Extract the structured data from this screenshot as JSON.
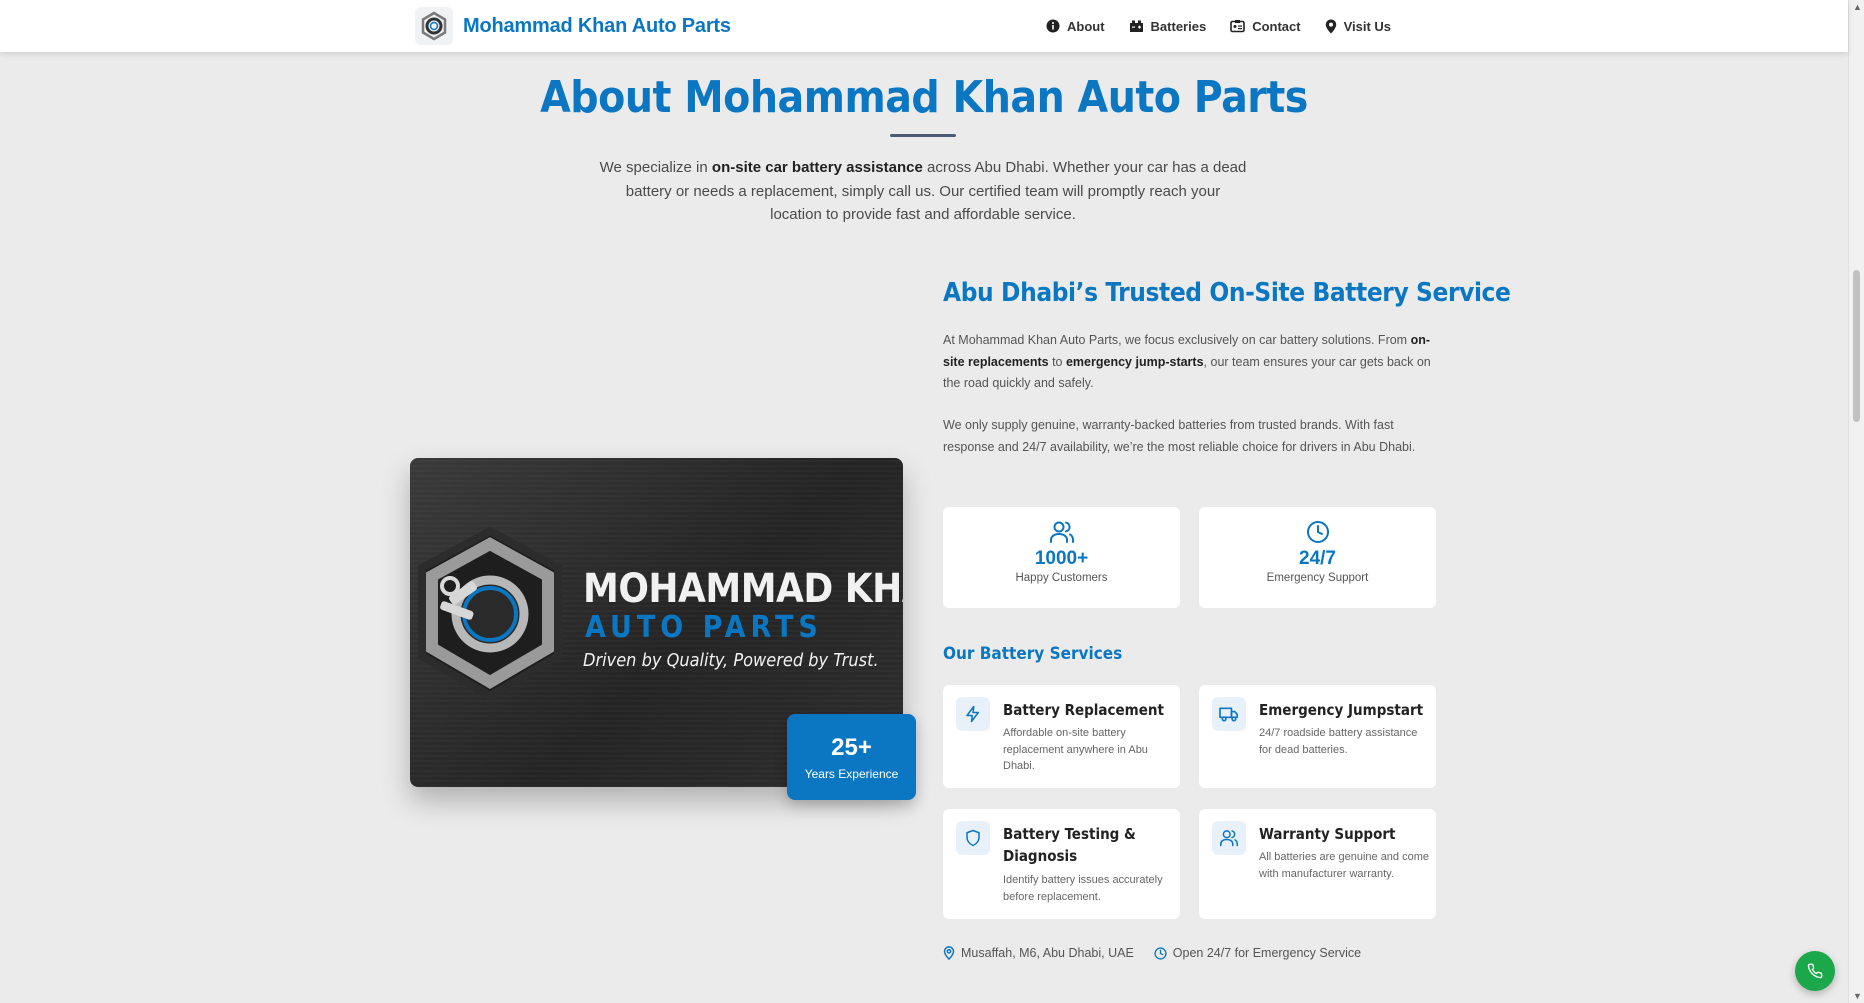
{
  "header": {
    "brand_name": "Mohammad Khan Auto Parts",
    "nav": [
      {
        "label": "About",
        "icon": "info-icon"
      },
      {
        "label": "Batteries",
        "icon": "battery-icon"
      },
      {
        "label": "Contact",
        "icon": "contact-card-icon"
      },
      {
        "label": "Visit Us",
        "icon": "map-pin-icon"
      }
    ]
  },
  "about": {
    "title": "About Mohammad Khan Auto Parts",
    "intro_pre": "We specialize in ",
    "intro_bold": "on-site car battery assistance",
    "intro_post": " across Abu Dhabi. Whether your car has a dead battery or needs a replacement, simply call us. Our certified team will promptly reach your location to provide fast and affordable service."
  },
  "image_card": {
    "line1": "MOHAMMAD KHAN",
    "line2": "AUTO PARTS",
    "tagline": "Driven by Quality, Powered by Trust.",
    "badge_number": "25+",
    "badge_label": "Years Experience"
  },
  "service": {
    "title": "Abu Dhabi’s Trusted On-Site Battery Service",
    "p1_a": "At Mohammad Khan Auto Parts, we focus exclusively on car battery solutions. From ",
    "p1_b1": "on-site replacements",
    "p1_c": " to ",
    "p1_b2": "emergency jump-starts",
    "p1_d": ", our team ensures your car gets back on the road quickly and safely.",
    "p2": "We only supply genuine, warranty-backed batteries from trusted brands. With fast response and 24/7 availability, we’re the most reliable choice for drivers in Abu Dhabi."
  },
  "stats": [
    {
      "value": "1000+",
      "label": "Happy Customers",
      "icon": "users-icon"
    },
    {
      "value": "24/7",
      "label": "Emergency Support",
      "icon": "clock-icon"
    }
  ],
  "services_title": "Our Battery Services",
  "services": [
    {
      "title": "Battery Replacement",
      "desc": "Affordable on-site battery replacement anywhere in Abu Dhabi.",
      "icon": "lightning-icon"
    },
    {
      "title": "Emergency Jumpstart",
      "desc": "24/7 roadside battery assistance for dead batteries.",
      "icon": "truck-icon"
    },
    {
      "title": "Battery Testing & Diagnosis",
      "desc": "Identify battery issues accurately before replacement.",
      "icon": "shield-icon"
    },
    {
      "title": "Warranty Support",
      "desc": "All batteries are genuine and come with manufacturer warranty.",
      "icon": "users-icon"
    }
  ],
  "footer": {
    "location": "Musaffah, M6, Abu Dhabi, UAE",
    "hours": "Open 24/7 for Emergency Service"
  },
  "colors": {
    "accent": "#0b77c2",
    "call_button": "#1aa84a",
    "background": "#ebebeb"
  }
}
